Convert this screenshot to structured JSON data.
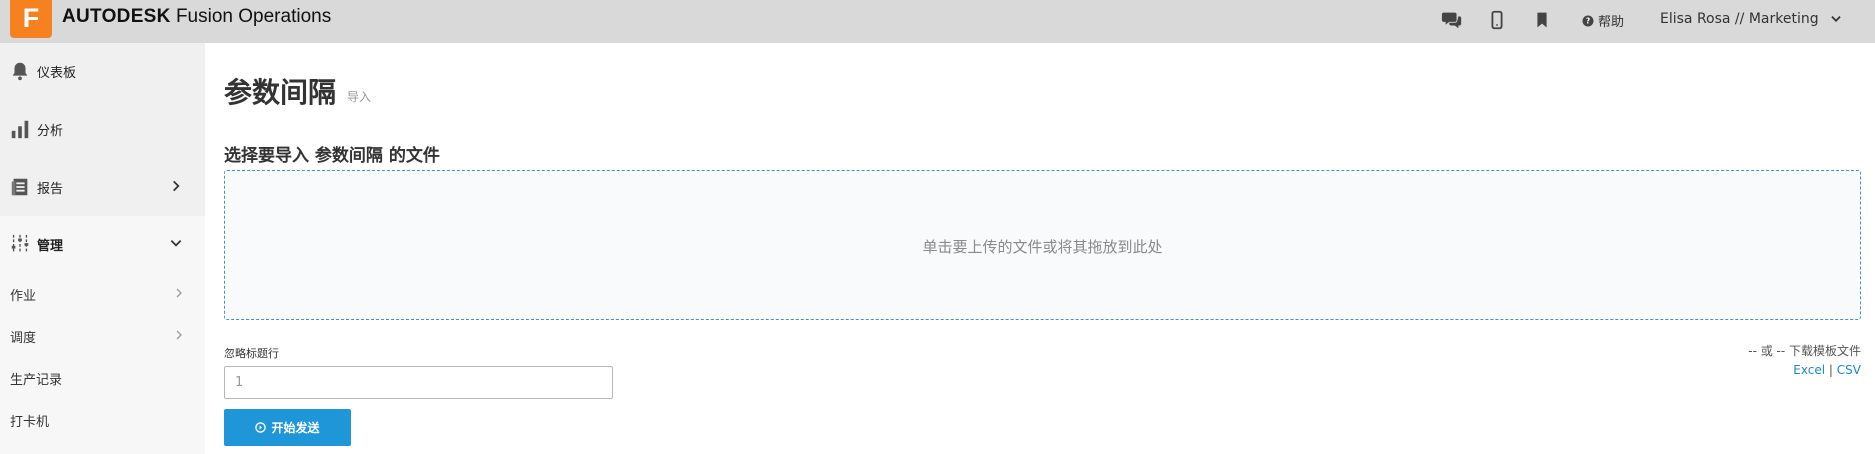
{
  "header": {
    "logo_letter": "F",
    "brand_bold": "AUTODESK",
    "brand_rest": "Fusion Operations",
    "icons": [
      "chat-icon",
      "mobile-icon",
      "bookmark-icon",
      "help-icon"
    ],
    "help_label": "帮助",
    "user_label": "Elisa Rosa // Marketing",
    "accent_color": "#f5821f"
  },
  "sidebar": {
    "items": [
      {
        "label": "仪表板",
        "icon": "bell-icon"
      },
      {
        "label": "分析",
        "icon": "bar-chart-icon"
      },
      {
        "label": "报告",
        "icon": "report-icon"
      },
      {
        "label": "管理",
        "icon": "sliders-icon"
      }
    ],
    "sub_items": [
      {
        "label": "作业"
      },
      {
        "label": "调度"
      },
      {
        "label": "生产记录"
      },
      {
        "label": "打卡机"
      }
    ]
  },
  "main": {
    "title": "参数间隔",
    "subtitle": "导入",
    "section_title": "选择要导入 参数间隔 的文件",
    "dropzone_text": "单击要上传的文件或将其拖放到此处",
    "skip_label": "忽略标题行",
    "skip_placeholder": "1",
    "send_label": "开始发送",
    "template_text": "-- 或 -- 下载模板文件",
    "excel_label": "Excel",
    "separator": "|",
    "csv_label": "CSV",
    "button_color": "#1f96d8"
  }
}
